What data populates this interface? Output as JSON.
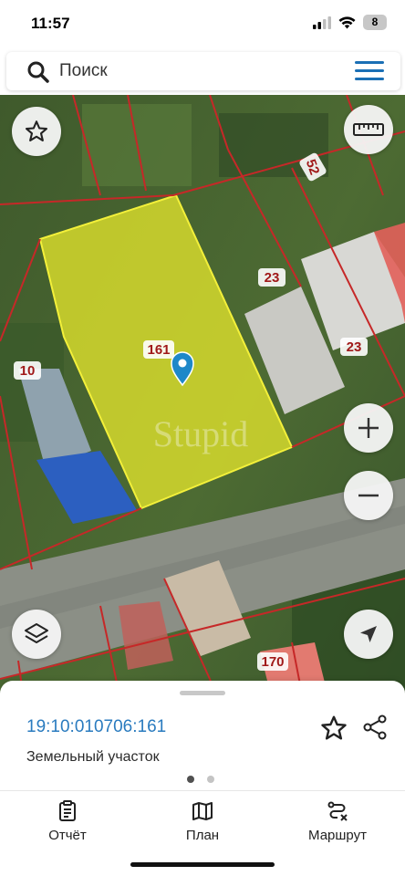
{
  "status_bar": {
    "time": "11:57",
    "battery": "8"
  },
  "search": {
    "placeholder": "Поиск",
    "value": ""
  },
  "map": {
    "parcel_labels": [
      "161",
      "23",
      "23",
      "52",
      "10",
      "170"
    ],
    "watermark": "Stupid",
    "colors": {
      "parcel_fill": "#e8ea2c",
      "boundary": "#c62828",
      "pin": "#1e88c9"
    }
  },
  "map_controls": {
    "favorite": "star-icon",
    "ruler": "ruler-icon",
    "zoom_in": "+",
    "zoom_out": "−",
    "layers": "layers-icon",
    "locate": "location-arrow-icon"
  },
  "sheet": {
    "cadastral_number": "19:10:010706:161",
    "parcel_type": "Земельный участок",
    "page_count": 2,
    "current_page": 1
  },
  "tabs": [
    {
      "label": "Отчёт",
      "icon": "report-icon"
    },
    {
      "label": "План",
      "icon": "map-plan-icon"
    },
    {
      "label": "Маршрут",
      "icon": "route-icon"
    }
  ]
}
